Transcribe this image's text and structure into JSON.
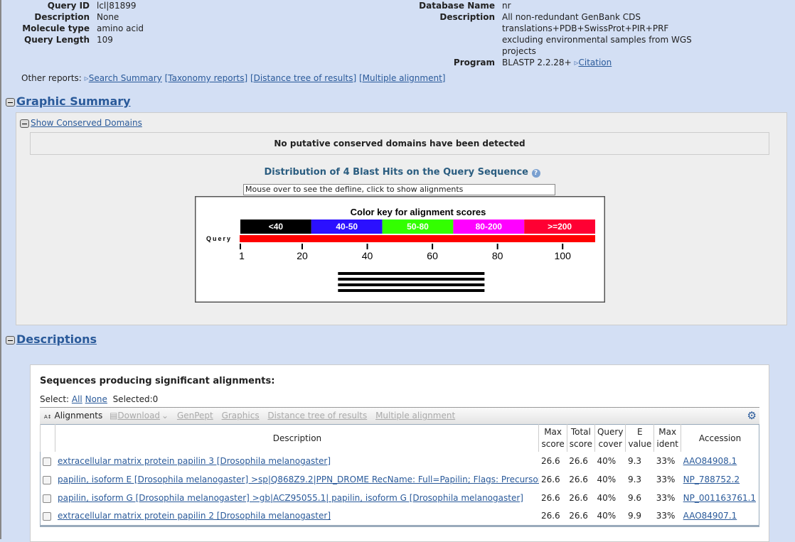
{
  "query": {
    "fields": [
      {
        "label": "Query ID",
        "value": "lcl|81899"
      },
      {
        "label": "Description",
        "value": "None"
      },
      {
        "label": "Molecule type",
        "value": "amino acid"
      },
      {
        "label": "Query Length",
        "value": "109"
      }
    ]
  },
  "database": {
    "name_label": "Database Name",
    "name": "nr",
    "desc_label": "Description",
    "desc_lines": [
      "All non-redundant GenBank CDS",
      "translations+PDB+SwissProt+PIR+PRF",
      "excluding environmental samples from WGS",
      "projects"
    ],
    "program_label": "Program",
    "program": "BLASTP 2.2.28+",
    "citation": "Citation"
  },
  "other_reports": {
    "label": "Other reports:",
    "links": [
      "Search Summary",
      "[Taxonomy reports]",
      "[Distance tree of results]",
      "[Multiple alignment]"
    ]
  },
  "graphic": {
    "title": "Graphic Summary",
    "cdd_toggle": "Show Conserved Domains",
    "cdd_msg": "No putative conserved domains have been detected",
    "dist_title": "Distribution of 4 Blast Hits on the Query Sequence",
    "mouseover": "Mouse over to see the defline, click to show alignments"
  },
  "chart_data": {
    "type": "bar",
    "title": "Color key for alignment scores",
    "query_label": "Query",
    "query_length": 109,
    "color_key": [
      {
        "label": "<40",
        "color": "#000000"
      },
      {
        "label": "40-50",
        "color": "#2b10ff"
      },
      {
        "label": "50-80",
        "color": "#33ff00"
      },
      {
        "label": "80-200",
        "color": "#ff00ff"
      },
      {
        "label": ">=200",
        "color": "#ff0033"
      }
    ],
    "ticks": [
      1,
      20,
      40,
      60,
      80,
      100
    ],
    "hits": [
      {
        "start": 31,
        "end": 75,
        "color": "#000000"
      },
      {
        "start": 31,
        "end": 75,
        "color": "#000000"
      },
      {
        "start": 31,
        "end": 75,
        "color": "#000000"
      },
      {
        "start": 31,
        "end": 75,
        "color": "#000000"
      }
    ]
  },
  "descriptions": {
    "title": "Descriptions",
    "heading": "Sequences producing significant alignments:",
    "select_label": "Select:",
    "all": "All",
    "none": "None",
    "selected": "Selected:0",
    "toolbar": {
      "alignments": "Alignments",
      "download": "Download",
      "genpept": "GenPept",
      "graphics": "Graphics",
      "tree": "Distance tree of results",
      "msa": "Multiple alignment"
    },
    "columns": [
      "Description",
      "Max score",
      "Total score",
      "Query cover",
      "E value",
      "Max ident",
      "Accession"
    ],
    "rows": [
      {
        "desc": "extracellular matrix protein papilin 3 [Drosophila melanogaster]",
        "max": "26.6",
        "total": "26.6",
        "cover": "40%",
        "e": "9.3",
        "ident": "33%",
        "acc": "AAO84908.1"
      },
      {
        "desc": "papilin, isoform E [Drosophila melanogaster] >sp|Q868Z9.2|PPN_DROME RecName: Full=Papilin; Flags: Precursor >gb|AAF",
        "max": "26.6",
        "total": "26.6",
        "cover": "40%",
        "e": "9.3",
        "ident": "33%",
        "acc": "NP_788752.2"
      },
      {
        "desc": "papilin, isoform G [Drosophila melanogaster] >gb|ACZ95055.1| papilin, isoform G [Drosophila melanogaster]",
        "max": "26.6",
        "total": "26.6",
        "cover": "40%",
        "e": "9.6",
        "ident": "33%",
        "acc": "NP_001163761.1"
      },
      {
        "desc": "extracellular matrix protein papilin 2 [Drosophila melanogaster]",
        "max": "26.6",
        "total": "26.6",
        "cover": "40%",
        "e": "9.9",
        "ident": "33%",
        "acc": "AAO84907.1"
      }
    ]
  }
}
